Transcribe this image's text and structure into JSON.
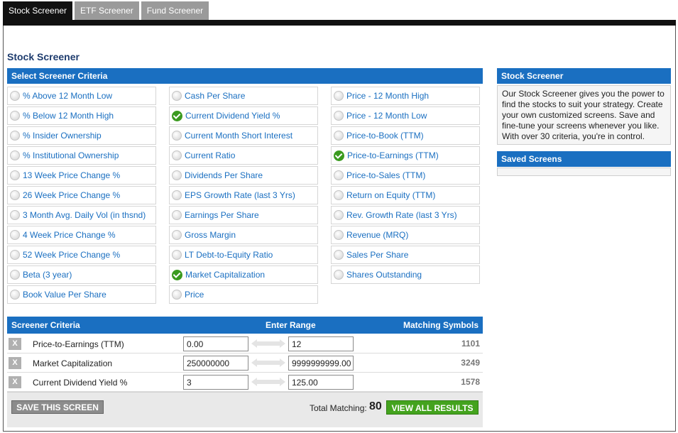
{
  "tabs": [
    {
      "label": "Stock Screener",
      "active": true
    },
    {
      "label": "ETF Screener",
      "active": false
    },
    {
      "label": "Fund Screener",
      "active": false
    }
  ],
  "page_title": "Stock Screener",
  "criteria_header": "Select Screener Criteria",
  "criteria_columns": [
    [
      {
        "label": "% Above 12 Month Low",
        "checked": false
      },
      {
        "label": "% Below 12 Month High",
        "checked": false
      },
      {
        "label": "% Insider Ownership",
        "checked": false
      },
      {
        "label": "% Institutional Ownership",
        "checked": false
      },
      {
        "label": "13 Week Price Change %",
        "checked": false
      },
      {
        "label": "26 Week Price Change %",
        "checked": false
      },
      {
        "label": "3 Month Avg. Daily Vol (in thsnd)",
        "checked": false
      },
      {
        "label": "4 Week Price Change %",
        "checked": false
      },
      {
        "label": "52 Week Price Change %",
        "checked": false
      },
      {
        "label": "Beta (3 year)",
        "checked": false
      },
      {
        "label": "Book Value Per Share",
        "checked": false
      }
    ],
    [
      {
        "label": "Cash Per Share",
        "checked": false
      },
      {
        "label": "Current Dividend Yield %",
        "checked": true
      },
      {
        "label": "Current Month Short Interest",
        "checked": false
      },
      {
        "label": "Current Ratio",
        "checked": false
      },
      {
        "label": "Dividends Per Share",
        "checked": false
      },
      {
        "label": "EPS Growth Rate (last 3 Yrs)",
        "checked": false
      },
      {
        "label": "Earnings Per Share",
        "checked": false
      },
      {
        "label": "Gross Margin",
        "checked": false
      },
      {
        "label": "LT Debt-to-Equity Ratio",
        "checked": false
      },
      {
        "label": "Market Capitalization",
        "checked": true
      },
      {
        "label": "Price",
        "checked": false
      }
    ],
    [
      {
        "label": "Price - 12 Month High",
        "checked": false
      },
      {
        "label": "Price - 12 Month Low",
        "checked": false
      },
      {
        "label": "Price-to-Book (TTM)",
        "checked": false
      },
      {
        "label": "Price-to-Earnings (TTM)",
        "checked": true
      },
      {
        "label": "Price-to-Sales (TTM)",
        "checked": false
      },
      {
        "label": "Return on Equity (TTM)",
        "checked": false
      },
      {
        "label": "Rev. Growth Rate (last 3 Yrs)",
        "checked": false
      },
      {
        "label": "Revenue (MRQ)",
        "checked": false
      },
      {
        "label": "Sales Per Share",
        "checked": false
      },
      {
        "label": "Shares Outstanding",
        "checked": false
      }
    ]
  ],
  "table": {
    "col_criteria": "Screener Criteria",
    "col_range": "Enter Range",
    "col_matching": "Matching Symbols",
    "remove_label": "X",
    "rows": [
      {
        "label": "Price-to-Earnings (TTM)",
        "min": "0.00",
        "max": "12",
        "matching": "1101"
      },
      {
        "label": "Market Capitalization",
        "min": "250000000",
        "max": "9999999999.00",
        "matching": "3249"
      },
      {
        "label": "Current Dividend Yield %",
        "min": "3",
        "max": "125.00",
        "matching": "1578"
      }
    ]
  },
  "footer": {
    "save_label": "SAVE THIS SCREEN",
    "total_label": "Total Matching:",
    "total_value": "80",
    "view_label": "VIEW ALL RESULTS"
  },
  "sidebar": {
    "screener_title": "Stock Screener",
    "screener_text": "Our Stock Screener gives you the power to find the stocks to suit your strategy. Create your own customized screens. Save and fine-tune your screens whenever you like. With over 30 criteria, you're in control.",
    "saved_title": "Saved Screens"
  },
  "colors": {
    "accent": "#1a6fc1",
    "check": "#3a9a1f",
    "view_button": "#44a31e"
  }
}
